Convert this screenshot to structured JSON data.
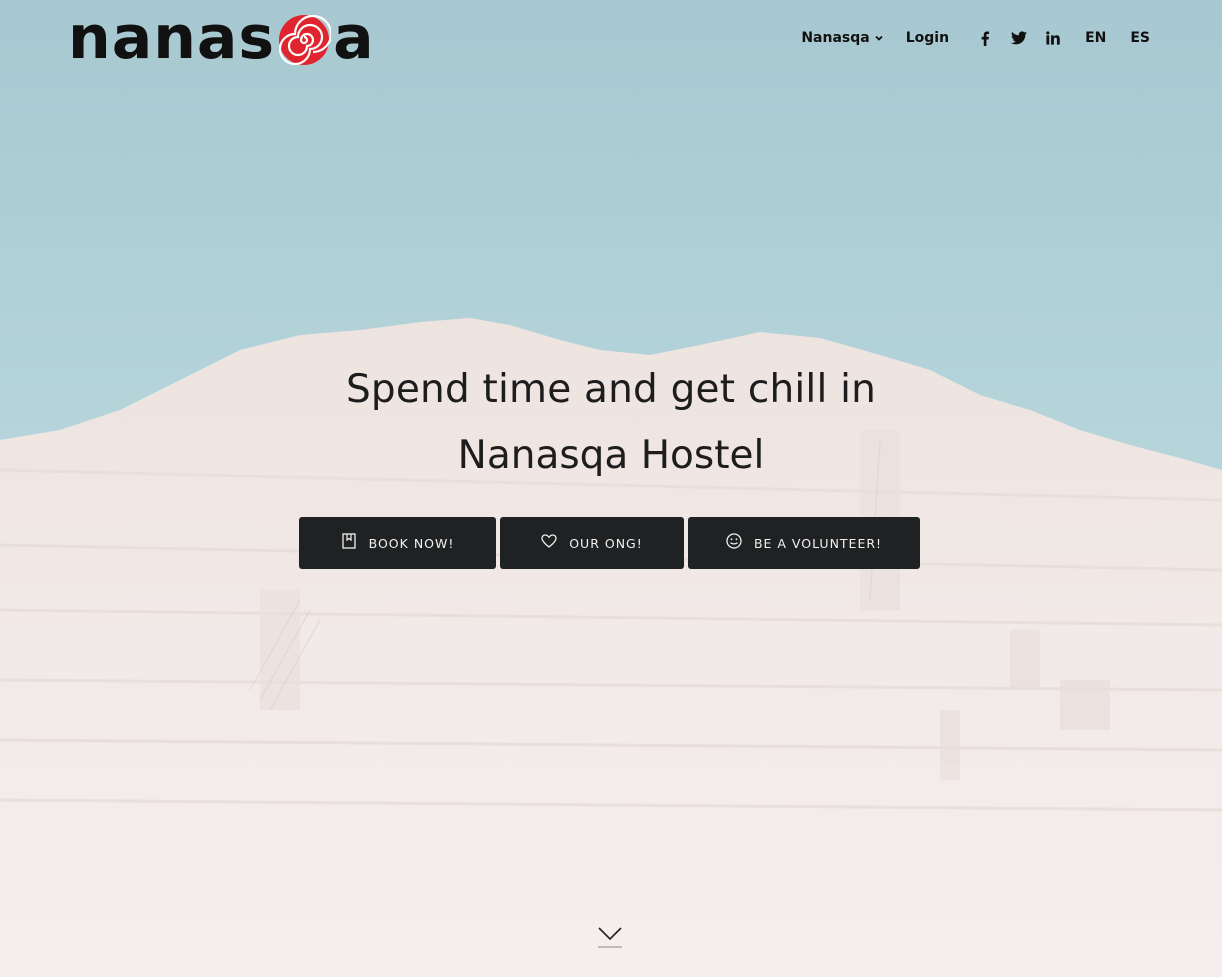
{
  "header": {
    "logo": {
      "text_left": "nanas",
      "text_right": "a",
      "spiral_icon": "spiral-icon",
      "spiral_color": "#e0252e"
    },
    "nav": {
      "menu_label": "Nanasqa",
      "login_label": "Login",
      "social": [
        "facebook-icon",
        "twitter-icon",
        "linkedin-icon"
      ],
      "lang_en": "EN",
      "lang_es": "ES"
    }
  },
  "hero": {
    "line1": "Spend time and get chill in",
    "line2": "Nanasqa Hostel",
    "buttons": [
      {
        "label": "BOOK NOW!",
        "icon": "book-icon"
      },
      {
        "label": "OUR ONG!",
        "icon": "heart-icon"
      },
      {
        "label": "BE A VOLUNTEER!",
        "icon": "smiley-icon"
      }
    ],
    "scroll_icon": "chevron-down-icon"
  },
  "colors": {
    "sky_top": "#a9c9d2",
    "sky_bottom": "#b6d6dc",
    "ground": "#f1e9e7",
    "button_bg": "#1f2123",
    "button_text": "#f1f1f1",
    "text": "#1d1d1d"
  }
}
